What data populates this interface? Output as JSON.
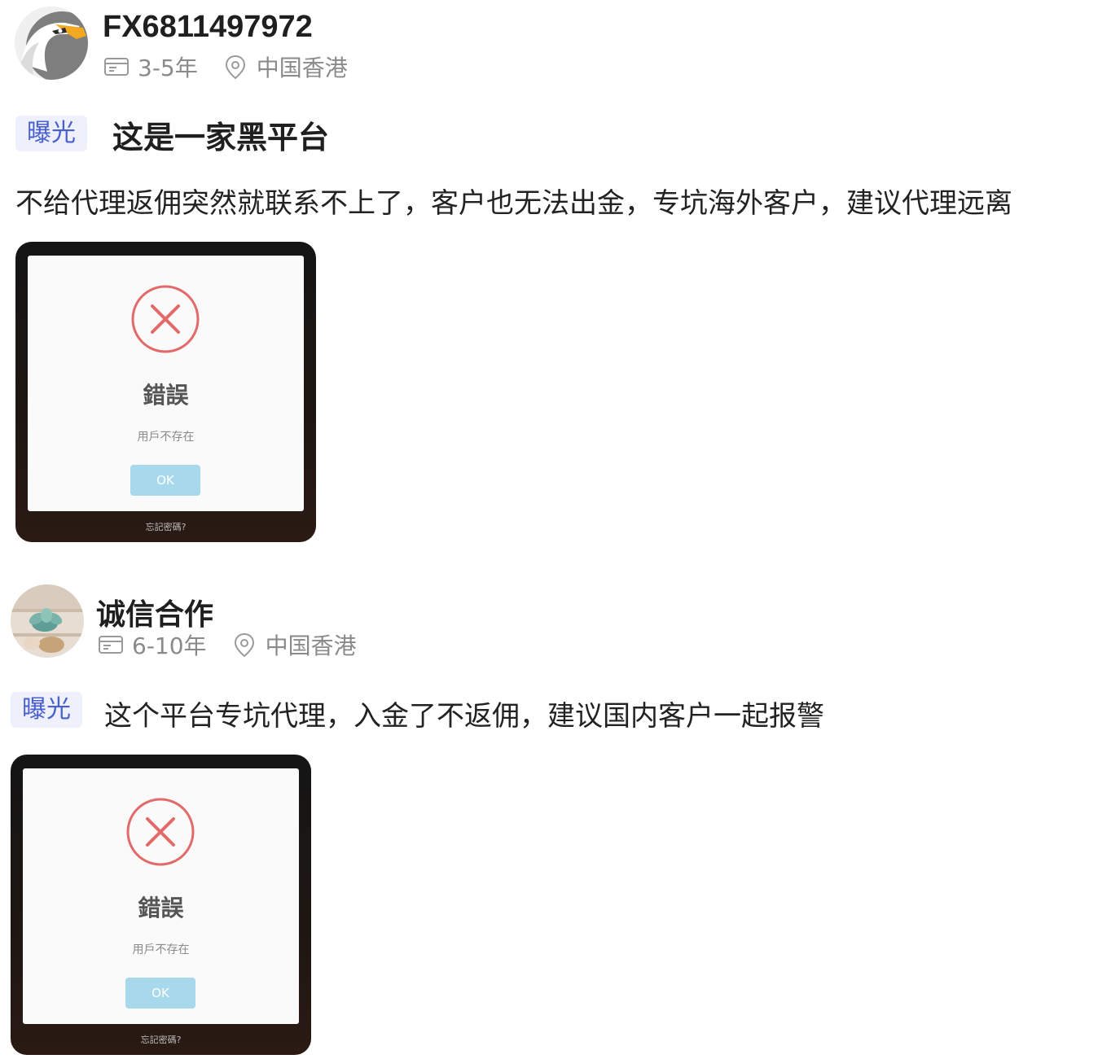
{
  "posts": [
    {
      "username": "FX6811497972",
      "experience": "3-5年",
      "location": "中国香港",
      "tag": "曝光",
      "title": "这是一家黑平台",
      "body": "不给代理返佣突然就联系不上了，客户也无法出金，专坑海外客户，建议代理远离",
      "screenshot": {
        "error_title": "錯誤",
        "error_message": "用戶不存在",
        "ok_label": "OK",
        "forgot_label": "忘記密碼?"
      }
    },
    {
      "username": "诚信合作",
      "experience": "6-10年",
      "location": "中国香港",
      "tag": "曝光",
      "body": "这个平台专坑代理，入金了不返佣，建议国内客户一起报警",
      "screenshot": {
        "error_title": "錯誤",
        "error_message": "用戶不存在",
        "ok_label": "OK",
        "forgot_label": "忘記密碼?"
      }
    }
  ],
  "icons": {
    "experience": "id-card-icon",
    "location": "location-pin-icon",
    "error": "x-circle-icon"
  },
  "colors": {
    "tag_bg": "#eef0fb",
    "tag_text": "#4a5fcf",
    "error_red": "#e26a6a",
    "ok_button": "#a8d8ec",
    "meta_gray": "#8a8a8a"
  }
}
